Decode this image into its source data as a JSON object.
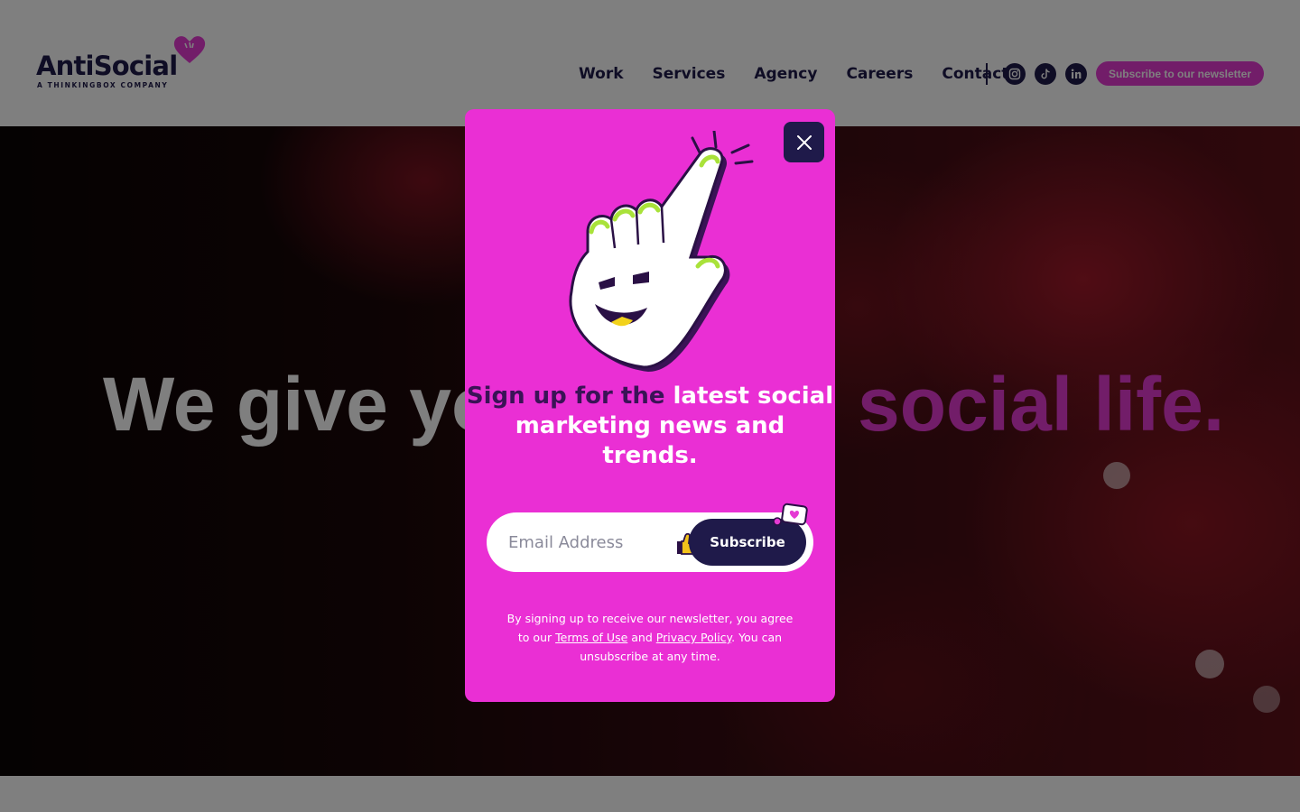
{
  "brand": {
    "name": "AntiSocial",
    "tagline": "A THINKINGBOX COMPANY",
    "accent": "#e53ad3",
    "dark": "#1f1a4a"
  },
  "nav": {
    "items": [
      {
        "label": "Work"
      },
      {
        "label": "Services"
      },
      {
        "label": "Agency"
      },
      {
        "label": "Careers"
      },
      {
        "label": "Contact"
      }
    ],
    "social": [
      "instagram-icon",
      "tiktok-icon",
      "linkedin-icon"
    ],
    "newsletter_button": "Subscribe to our newsletter"
  },
  "hero": {
    "left_text": "We give yo",
    "right_text": "social life."
  },
  "modal": {
    "headline_part1": "Sign up for the ",
    "headline_part2": "latest social marketing news and trends.",
    "email_placeholder": "Email Address",
    "subscribe_label": "Subscribe",
    "legal_prefix": "By signing up to receive our newsletter, you agree to our ",
    "terms_label": "Terms of Use",
    "legal_and": " and ",
    "privacy_label": "Privacy Policy",
    "legal_suffix": ". You can unsubscribe at any time."
  }
}
